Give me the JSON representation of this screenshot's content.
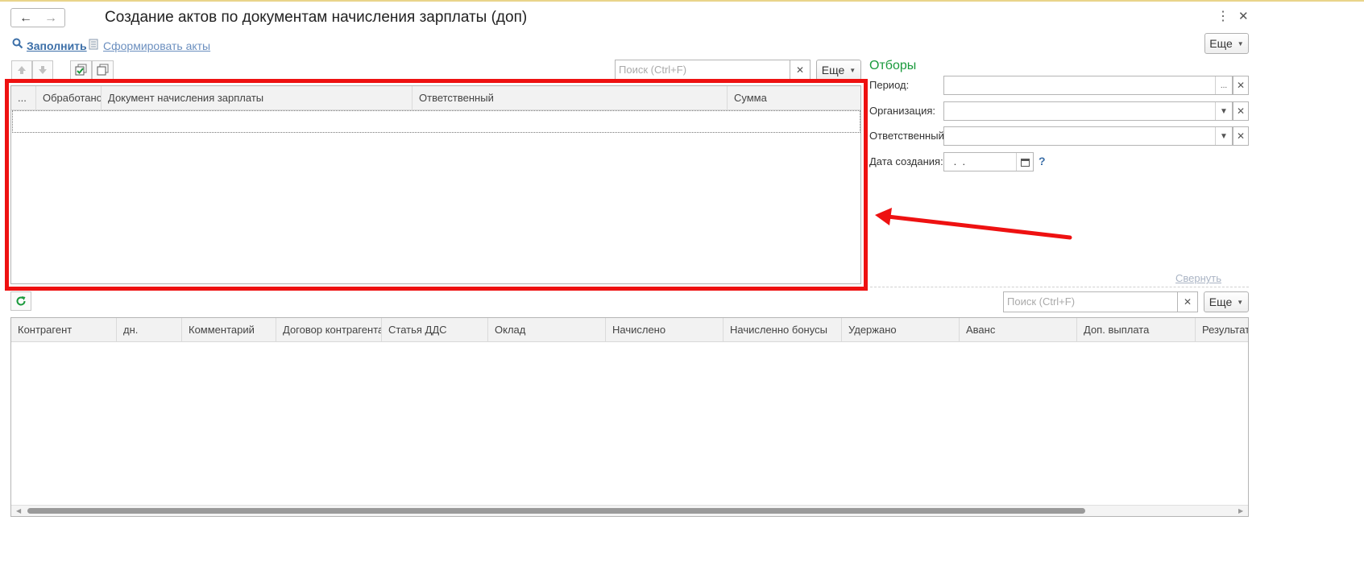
{
  "window": {
    "title": "Создание актов по документам начисления зарплаты (доп)",
    "back_icon": "←",
    "forward_icon": "→",
    "more_icon": "⋮",
    "close_icon": "✕"
  },
  "commands": {
    "fill_label": "Заполнить",
    "form_acts_label": "Сформировать акты",
    "more_label": "Еще"
  },
  "top_table": {
    "search_placeholder": "Поиск (Ctrl+F)",
    "more_label": "Еще",
    "columns": [
      "...",
      "Обработано",
      "Документ начисления зарплаты",
      "Ответственный",
      "Сумма"
    ]
  },
  "filters": {
    "title": "Отборы",
    "period_label": "Период:",
    "organization_label": "Организация:",
    "responsible_label": "Ответственный:",
    "created_date_label": "Дата создания:",
    "created_date_value": " .  .",
    "help_mark": "?",
    "ellipsis": "...",
    "collapse_label": "Свернуть"
  },
  "bottom_table": {
    "search_placeholder": "Поиск (Ctrl+F)",
    "more_label": "Еще",
    "columns": [
      "Контрагент",
      "дн.",
      "Комментарий",
      "Договор контрагента",
      "Статья ДДС",
      "Оклад",
      "Начислено",
      "Начисленно бонусы",
      "Удержано",
      "Аванс",
      "Доп. выплата",
      "Результат"
    ]
  },
  "colors": {
    "accent_green": "#1a9a3c",
    "link_blue": "#3c6fa8",
    "annotation_red": "#ee1111"
  }
}
